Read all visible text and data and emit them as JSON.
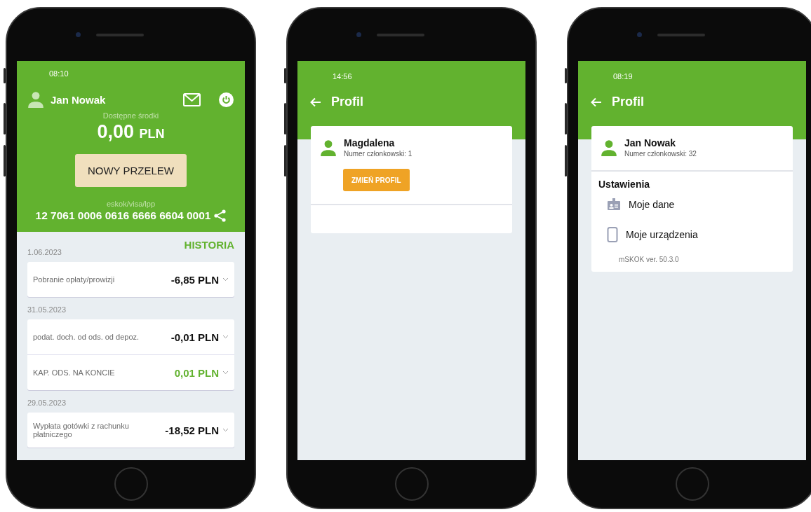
{
  "phones": [
    {
      "kind": "dashboard",
      "status_time": "08:10",
      "user_name": "Jan Nowak",
      "balance_label": "Dostępne środki",
      "balance_amount": "0,00",
      "balance_currency": "PLN",
      "primary_button": "NOWY PRZELEW",
      "account_label": "eskok/visa/lpp",
      "account_number": "12 7061 0006 0616 6666 6604 0001",
      "history_title": "HISTORIA",
      "groups": [
        {
          "date": "1.06.2023",
          "transactions": [
            {
              "description": "Pobranie opłaty/prowizji",
              "amount": "-6,85 PLN",
              "credit": false
            }
          ]
        },
        {
          "date": "31.05.2023",
          "transactions": [
            {
              "description": "podat. doch. od ods. od depoz.",
              "amount": "-0,01 PLN",
              "credit": false
            },
            {
              "description": "KAP. ODS. NA KONCIE",
              "amount": "0,01 PLN",
              "credit": true
            }
          ]
        },
        {
          "date": "29.05.2023",
          "transactions": [
            {
              "description": "Wypłata gotówki z rachunku płatniczego",
              "amount": "-18,52 PLN",
              "credit": false
            }
          ]
        }
      ]
    },
    {
      "kind": "profile",
      "status_time": "14:56",
      "title": "Profil",
      "profile_name": "Magdalena",
      "member_number": "Numer członkowski: 1",
      "button": "ZMIEŃ PROFIL"
    },
    {
      "kind": "profile",
      "status_time": "08:19",
      "title": "Profil",
      "profile_name": "Jan Nowak",
      "member_number": "Numer członkowski: 32",
      "settings_title": "Ustawienia",
      "settings": [
        {
          "kind": "id-card",
          "label": "Moje dane"
        },
        {
          "kind": "device",
          "label": "Moje urządzenia"
        }
      ],
      "version": "mSKOK ver. 50.3.0"
    }
  ]
}
